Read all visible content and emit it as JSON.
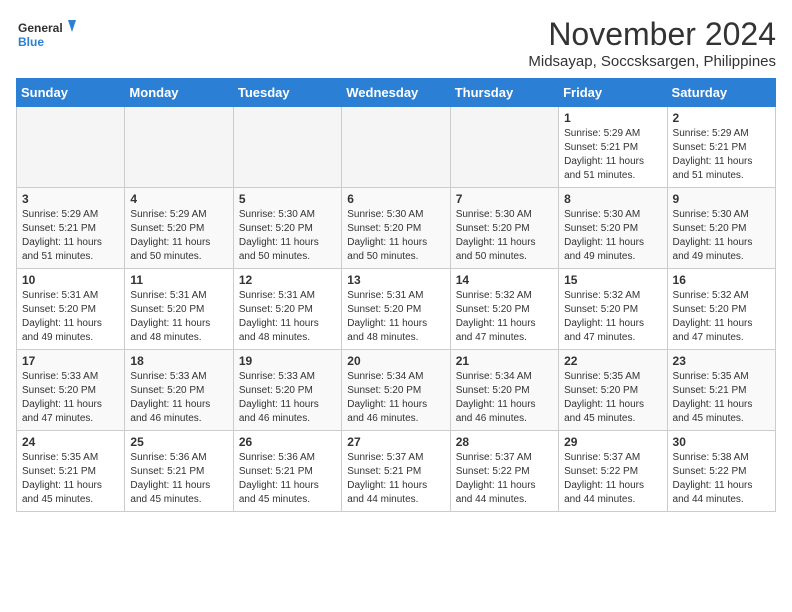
{
  "header": {
    "logo_line1": "General",
    "logo_line2": "Blue",
    "month": "November 2024",
    "location": "Midsayap, Soccsksargen, Philippines"
  },
  "weekdays": [
    "Sunday",
    "Monday",
    "Tuesday",
    "Wednesday",
    "Thursday",
    "Friday",
    "Saturday"
  ],
  "weeks": [
    [
      {
        "day": "",
        "info": ""
      },
      {
        "day": "",
        "info": ""
      },
      {
        "day": "",
        "info": ""
      },
      {
        "day": "",
        "info": ""
      },
      {
        "day": "",
        "info": ""
      },
      {
        "day": "1",
        "info": "Sunrise: 5:29 AM\nSunset: 5:21 PM\nDaylight: 11 hours\nand 51 minutes."
      },
      {
        "day": "2",
        "info": "Sunrise: 5:29 AM\nSunset: 5:21 PM\nDaylight: 11 hours\nand 51 minutes."
      }
    ],
    [
      {
        "day": "3",
        "info": "Sunrise: 5:29 AM\nSunset: 5:21 PM\nDaylight: 11 hours\nand 51 minutes."
      },
      {
        "day": "4",
        "info": "Sunrise: 5:29 AM\nSunset: 5:20 PM\nDaylight: 11 hours\nand 50 minutes."
      },
      {
        "day": "5",
        "info": "Sunrise: 5:30 AM\nSunset: 5:20 PM\nDaylight: 11 hours\nand 50 minutes."
      },
      {
        "day": "6",
        "info": "Sunrise: 5:30 AM\nSunset: 5:20 PM\nDaylight: 11 hours\nand 50 minutes."
      },
      {
        "day": "7",
        "info": "Sunrise: 5:30 AM\nSunset: 5:20 PM\nDaylight: 11 hours\nand 50 minutes."
      },
      {
        "day": "8",
        "info": "Sunrise: 5:30 AM\nSunset: 5:20 PM\nDaylight: 11 hours\nand 49 minutes."
      },
      {
        "day": "9",
        "info": "Sunrise: 5:30 AM\nSunset: 5:20 PM\nDaylight: 11 hours\nand 49 minutes."
      }
    ],
    [
      {
        "day": "10",
        "info": "Sunrise: 5:31 AM\nSunset: 5:20 PM\nDaylight: 11 hours\nand 49 minutes."
      },
      {
        "day": "11",
        "info": "Sunrise: 5:31 AM\nSunset: 5:20 PM\nDaylight: 11 hours\nand 48 minutes."
      },
      {
        "day": "12",
        "info": "Sunrise: 5:31 AM\nSunset: 5:20 PM\nDaylight: 11 hours\nand 48 minutes."
      },
      {
        "day": "13",
        "info": "Sunrise: 5:31 AM\nSunset: 5:20 PM\nDaylight: 11 hours\nand 48 minutes."
      },
      {
        "day": "14",
        "info": "Sunrise: 5:32 AM\nSunset: 5:20 PM\nDaylight: 11 hours\nand 47 minutes."
      },
      {
        "day": "15",
        "info": "Sunrise: 5:32 AM\nSunset: 5:20 PM\nDaylight: 11 hours\nand 47 minutes."
      },
      {
        "day": "16",
        "info": "Sunrise: 5:32 AM\nSunset: 5:20 PM\nDaylight: 11 hours\nand 47 minutes."
      }
    ],
    [
      {
        "day": "17",
        "info": "Sunrise: 5:33 AM\nSunset: 5:20 PM\nDaylight: 11 hours\nand 47 minutes."
      },
      {
        "day": "18",
        "info": "Sunrise: 5:33 AM\nSunset: 5:20 PM\nDaylight: 11 hours\nand 46 minutes."
      },
      {
        "day": "19",
        "info": "Sunrise: 5:33 AM\nSunset: 5:20 PM\nDaylight: 11 hours\nand 46 minutes."
      },
      {
        "day": "20",
        "info": "Sunrise: 5:34 AM\nSunset: 5:20 PM\nDaylight: 11 hours\nand 46 minutes."
      },
      {
        "day": "21",
        "info": "Sunrise: 5:34 AM\nSunset: 5:20 PM\nDaylight: 11 hours\nand 46 minutes."
      },
      {
        "day": "22",
        "info": "Sunrise: 5:35 AM\nSunset: 5:20 PM\nDaylight: 11 hours\nand 45 minutes."
      },
      {
        "day": "23",
        "info": "Sunrise: 5:35 AM\nSunset: 5:21 PM\nDaylight: 11 hours\nand 45 minutes."
      }
    ],
    [
      {
        "day": "24",
        "info": "Sunrise: 5:35 AM\nSunset: 5:21 PM\nDaylight: 11 hours\nand 45 minutes."
      },
      {
        "day": "25",
        "info": "Sunrise: 5:36 AM\nSunset: 5:21 PM\nDaylight: 11 hours\nand 45 minutes."
      },
      {
        "day": "26",
        "info": "Sunrise: 5:36 AM\nSunset: 5:21 PM\nDaylight: 11 hours\nand 45 minutes."
      },
      {
        "day": "27",
        "info": "Sunrise: 5:37 AM\nSunset: 5:21 PM\nDaylight: 11 hours\nand 44 minutes."
      },
      {
        "day": "28",
        "info": "Sunrise: 5:37 AM\nSunset: 5:22 PM\nDaylight: 11 hours\nand 44 minutes."
      },
      {
        "day": "29",
        "info": "Sunrise: 5:37 AM\nSunset: 5:22 PM\nDaylight: 11 hours\nand 44 minutes."
      },
      {
        "day": "30",
        "info": "Sunrise: 5:38 AM\nSunset: 5:22 PM\nDaylight: 11 hours\nand 44 minutes."
      }
    ]
  ]
}
